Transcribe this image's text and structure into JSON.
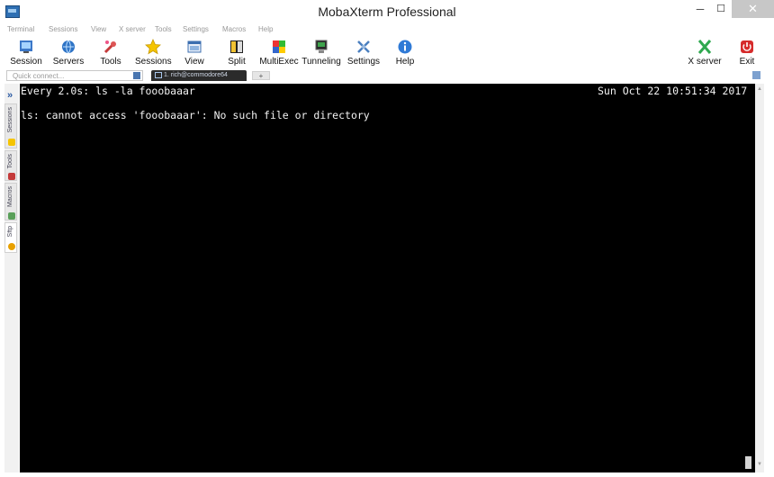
{
  "window": {
    "title": "MobaXterm Professional"
  },
  "window_controls": {
    "minimize": "─",
    "maximize": "☐",
    "close": "✕"
  },
  "menu": [
    "Terminal",
    "Sessions",
    "View",
    "X server",
    "Tools",
    "Settings",
    "Macros",
    "Help"
  ],
  "toolbar": {
    "items": [
      {
        "label": "Session",
        "icon": "session-icon"
      },
      {
        "label": "Servers",
        "icon": "servers-icon"
      },
      {
        "label": "Tools",
        "icon": "tools-icon"
      },
      {
        "label": "Sessions",
        "icon": "star-icon"
      },
      {
        "label": "View",
        "icon": "view-icon"
      },
      {
        "label": "Split",
        "icon": "split-icon"
      },
      {
        "label": "MultiExec",
        "icon": "multiexec-icon"
      },
      {
        "label": "Tunneling",
        "icon": "tunneling-icon"
      },
      {
        "label": "Settings",
        "icon": "settings-icon"
      },
      {
        "label": "Help",
        "icon": "help-icon"
      }
    ],
    "right_items": [
      {
        "label": "X server",
        "icon": "x-server-icon"
      },
      {
        "label": "Exit",
        "icon": "exit-icon"
      }
    ]
  },
  "quick_connect": {
    "placeholder": "Quick connect..."
  },
  "tabs": [
    {
      "label": "1. rich@commodore64"
    }
  ],
  "new_tab": "+",
  "sidebar": {
    "tabs": [
      "Sessions",
      "Tools",
      "Macros",
      "Sftp"
    ]
  },
  "terminal": {
    "header_left": "Every 2.0s: ls -la fooobaaar",
    "header_right": "Sun Oct 22 10:51:34 2017",
    "output": "ls: cannot access 'fooobaaar': No such file or directory"
  },
  "colors": {
    "terminal_bg": "#000000",
    "terminal_fg": "#f2f2f2",
    "accent": "#2e6fb3",
    "close_hover": "#c7c7c7"
  }
}
